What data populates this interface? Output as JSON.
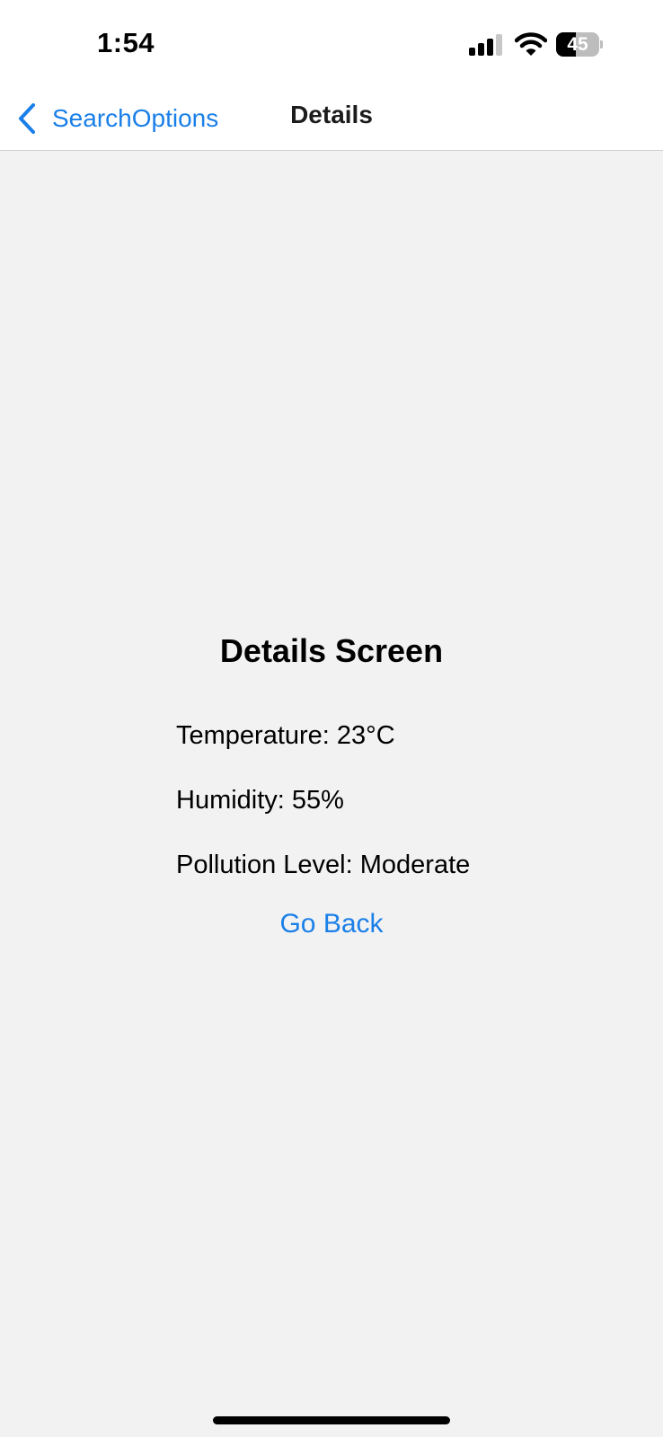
{
  "status_bar": {
    "time": "1:54",
    "signal_icon": "cellular-signal-icon",
    "wifi_icon": "wifi-icon",
    "battery_level": 45,
    "battery_text": "45"
  },
  "nav": {
    "back_icon": "chevron-left-icon",
    "back_label": "SearchOptions",
    "title": "Details"
  },
  "details": {
    "heading": "Details Screen",
    "temperature": "Temperature: 23°C",
    "humidity": "Humidity: 55%",
    "pollution": "Pollution Level: Moderate",
    "go_back": "Go Back"
  },
  "colors": {
    "accent": "#1a7fe8",
    "background": "#f2f2f2"
  }
}
